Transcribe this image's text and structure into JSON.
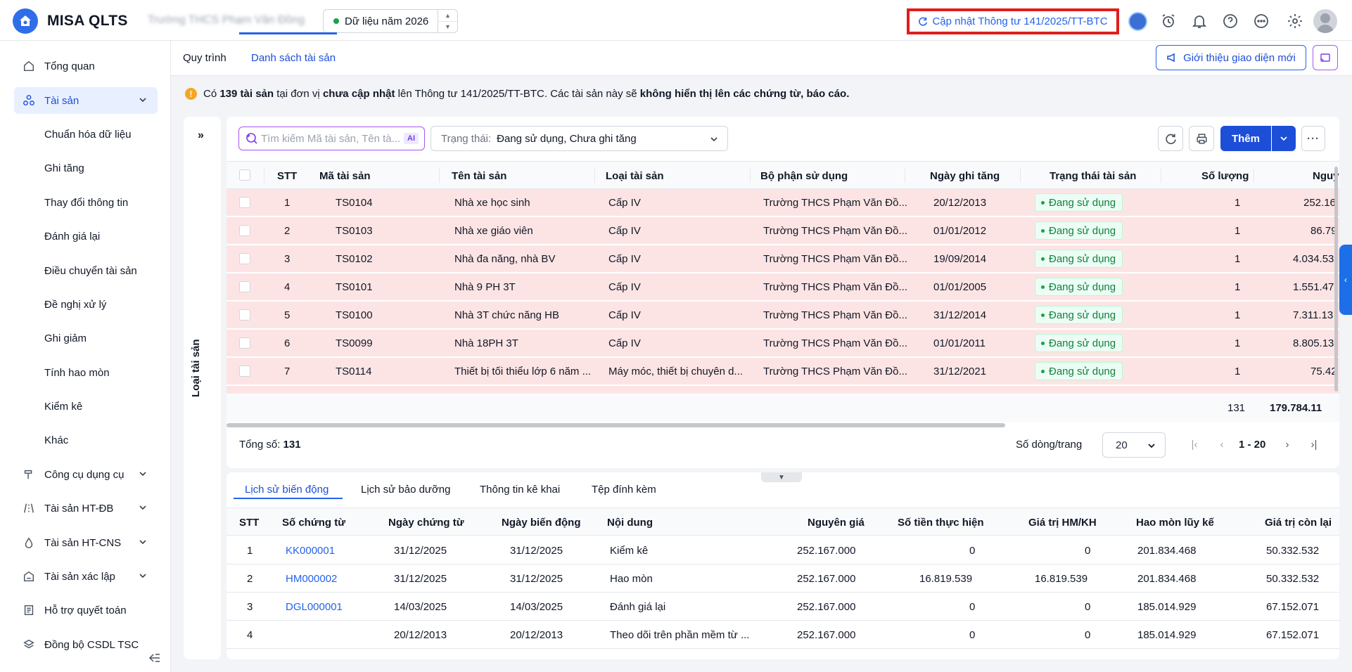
{
  "app": {
    "name": "MISA QLTS",
    "unit_name": "Trường THCS Phạm Văn Đồng",
    "year_label": "Dữ liệu năm 2026",
    "update_button": "Cập nhật Thông tư 141/2025/TT-BTC"
  },
  "sidebar": {
    "items": [
      {
        "label": "Tổng quan",
        "icon": "home-icon"
      },
      {
        "label": "Tài sản",
        "icon": "assets-icon",
        "active": true
      },
      {
        "label": "Công cụ dụng cụ",
        "icon": "tools-icon"
      },
      {
        "label": "Tài sản HT-ĐB",
        "icon": "road-icon"
      },
      {
        "label": "Tài sản HT-CNS",
        "icon": "water-drop-icon"
      },
      {
        "label": "Tài sản xác lập",
        "icon": "box-icon"
      },
      {
        "label": "Hỗ trợ quyết toán",
        "icon": "ledger-icon"
      },
      {
        "label": "Đồng bộ CSDL TSC",
        "icon": "sync-layers-icon"
      }
    ],
    "sub_items": [
      "Chuẩn hóa dữ liệu",
      "Ghi tăng",
      "Thay đổi thông tin",
      "Đánh giá lại",
      "Điều chuyển tài sản",
      "Đề nghị xử lý",
      "Ghi giảm",
      "Tính hao mòn",
      "Kiểm kê",
      "Khác"
    ]
  },
  "main": {
    "tabs": [
      "Quy trình",
      "Danh sách tài sản"
    ],
    "intro_button": "Giới thiệu giao diện mới",
    "notice": {
      "p1": "Có ",
      "count": "139 tài sản",
      "p2": " tại đơn vị ",
      "status": "chưa cập nhật",
      "p3": " lên Thông tư 141/2025/TT-BTC. Các tài sản này sẽ ",
      "warning": "không hiển thị lên các chứng từ, báo cáo."
    },
    "category_panel_label": "Loại tài sản"
  },
  "toolbar": {
    "search_placeholder": "Tìm kiếm Mã tài sản, Tên tà...",
    "ai_badge": "AI",
    "status_label": "Trạng thái:",
    "status_value": "Đang sử dụng, Chưa ghi tăng",
    "add_label": "Thêm"
  },
  "asset_table": {
    "headers": [
      "STT",
      "Mã tài sản",
      "Tên tài sản",
      "Loại tài sản",
      "Bộ phận sử dụng",
      "Ngày ghi tăng",
      "Trạng thái tài sản",
      "Số lượng",
      "Nguy"
    ],
    "rows": [
      {
        "stt": "1",
        "code": "TS0104",
        "name": "Nhà xe học sinh",
        "type": "Cấp IV",
        "dept": "Trường THCS Phạm Văn Đồ...",
        "date": "20/12/2013",
        "status": "Đang sử dụng",
        "qty": "1",
        "price": "252.16"
      },
      {
        "stt": "2",
        "code": "TS0103",
        "name": "Nhà xe giáo viên",
        "type": "Cấp IV",
        "dept": "Trường THCS Phạm Văn Đồ...",
        "date": "01/01/2012",
        "status": "Đang sử dụng",
        "qty": "1",
        "price": "86.79"
      },
      {
        "stt": "3",
        "code": "TS0102",
        "name": "Nhà đa năng, nhà BV",
        "type": "Cấp IV",
        "dept": "Trường THCS Phạm Văn Đồ...",
        "date": "19/09/2014",
        "status": "Đang sử dụng",
        "qty": "1",
        "price": "4.034.53"
      },
      {
        "stt": "4",
        "code": "TS0101",
        "name": "Nhà 9 PH 3T",
        "type": "Cấp IV",
        "dept": "Trường THCS Phạm Văn Đồ...",
        "date": "01/01/2005",
        "status": "Đang sử dụng",
        "qty": "1",
        "price": "1.551.47"
      },
      {
        "stt": "5",
        "code": "TS0100",
        "name": "Nhà 3T chức năng HB",
        "type": "Cấp IV",
        "dept": "Trường THCS Phạm Văn Đồ...",
        "date": "31/12/2014",
        "status": "Đang sử dụng",
        "qty": "1",
        "price": "7.311.13"
      },
      {
        "stt": "6",
        "code": "TS0099",
        "name": "Nhà 18PH 3T",
        "type": "Cấp IV",
        "dept": "Trường THCS Phạm Văn Đồ...",
        "date": "01/01/2011",
        "status": "Đang sử dụng",
        "qty": "1",
        "price": "8.805.13"
      },
      {
        "stt": "7",
        "code": "TS0114",
        "name": "Thiết bị tối thiểu lớp 6 năm ...",
        "type": "Máy móc, thiết bị chuyên d...",
        "dept": "Trường THCS Phạm Văn Đồ...",
        "date": "31/12/2021",
        "status": "Đang sử dụng",
        "qty": "1",
        "price": "75.42"
      }
    ],
    "total_qty": "131",
    "total_price": "179.784.11"
  },
  "pagination": {
    "total_label": "Tổng số:",
    "total_value": "131",
    "rows_per_page_label": "Số dòng/trang",
    "rows_per_page": "20",
    "range": "1 - 20"
  },
  "detail": {
    "tabs": [
      "Lịch sử biến động",
      "Lịch sử bảo dưỡng",
      "Thông tin kê khai",
      "Tệp đính kèm"
    ],
    "headers": [
      "STT",
      "Số chứng từ",
      "Ngày chứng từ",
      "Ngày biến động",
      "Nội dung",
      "Nguyên giá",
      "Số tiền thực hiện",
      "Giá trị HM/KH",
      "Hao mòn lũy kế",
      "Giá trị còn lại"
    ],
    "rows": [
      {
        "stt": "1",
        "doc": "KK000001",
        "doc_date": "31/12/2025",
        "change_date": "31/12/2025",
        "content": "Kiểm kê",
        "price": "252.167.000",
        "amount": "0",
        "hm": "0",
        "acc": "201.834.468",
        "remain": "50.332.532"
      },
      {
        "stt": "2",
        "doc": "HM000002",
        "doc_date": "31/12/2025",
        "change_date": "31/12/2025",
        "content": "Hao mòn",
        "price": "252.167.000",
        "amount": "16.819.539",
        "hm": "16.819.539",
        "acc": "201.834.468",
        "remain": "50.332.532"
      },
      {
        "stt": "3",
        "doc": "DGL000001",
        "doc_date": "14/03/2025",
        "change_date": "14/03/2025",
        "content": "Đánh giá lại",
        "price": "252.167.000",
        "amount": "0",
        "hm": "0",
        "acc": "185.014.929",
        "remain": "67.152.071"
      },
      {
        "stt": "4",
        "doc": "",
        "doc_date": "20/12/2013",
        "change_date": "20/12/2013",
        "content": "Theo dõi trên phần mềm từ ...",
        "price": "252.167.000",
        "amount": "0",
        "hm": "0",
        "acc": "185.014.929",
        "remain": "67.152.071"
      }
    ]
  },
  "colors": {
    "primary": "#1d4ed8",
    "highlight_row": "#fde4e4",
    "alert_border": "#e11d1d",
    "status_green": "#16a34a"
  }
}
